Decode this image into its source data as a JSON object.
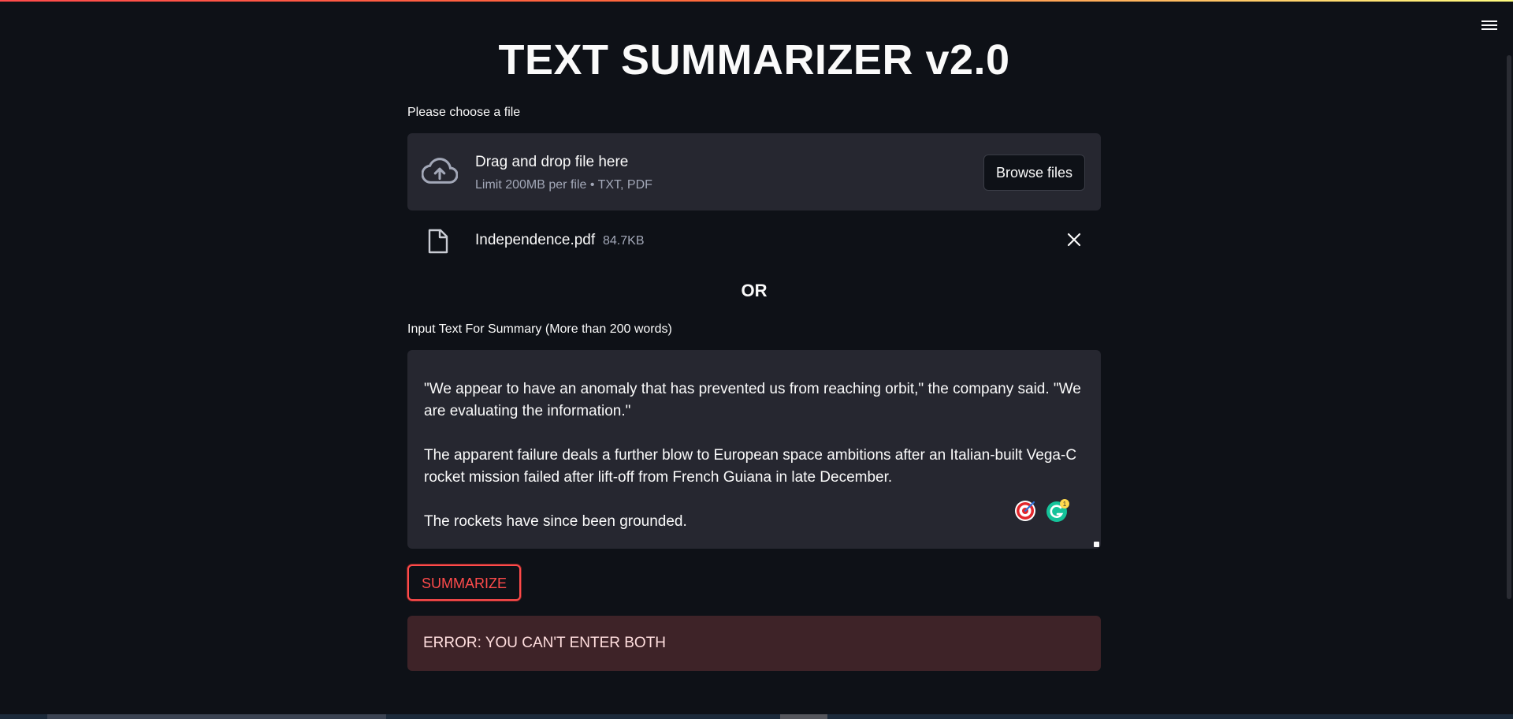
{
  "app": {
    "title": "TEXT SUMMARIZER v2.0",
    "accent_color": "#ff4b4b",
    "background_color": "#0e1117"
  },
  "uploader": {
    "label": "Please choose a file",
    "drop_title": "Drag and drop file here",
    "drop_subtitle": "Limit 200MB per file • TXT, PDF",
    "browse_label": "Browse files",
    "icon": "cloud-upload-icon"
  },
  "uploaded_file": {
    "name": "Independence.pdf",
    "size": "84.7KB",
    "icon": "file-icon",
    "remove_icon": "close-icon"
  },
  "separator": {
    "text": "OR"
  },
  "text_input": {
    "label": "Input Text For Summary (More than 200 words)",
    "paragraphs": [
      "\"We appear to have an anomaly that has prevented us from reaching orbit,\" the company said. \"We are evaluating the information.\"",
      "The apparent failure deals a further blow to European space ambitions after an Italian-built Vega-C rocket mission failed after lift-off from French Guiana in late December.",
      "The rockets have since been grounded."
    ],
    "extension_badge_count": "1"
  },
  "actions": {
    "summarize_label": "SUMMARIZE"
  },
  "error": {
    "message": "ERROR: YOU CAN'T ENTER BOTH",
    "color": "#3e2328"
  },
  "menu": {
    "icon": "hamburger-menu-icon"
  }
}
